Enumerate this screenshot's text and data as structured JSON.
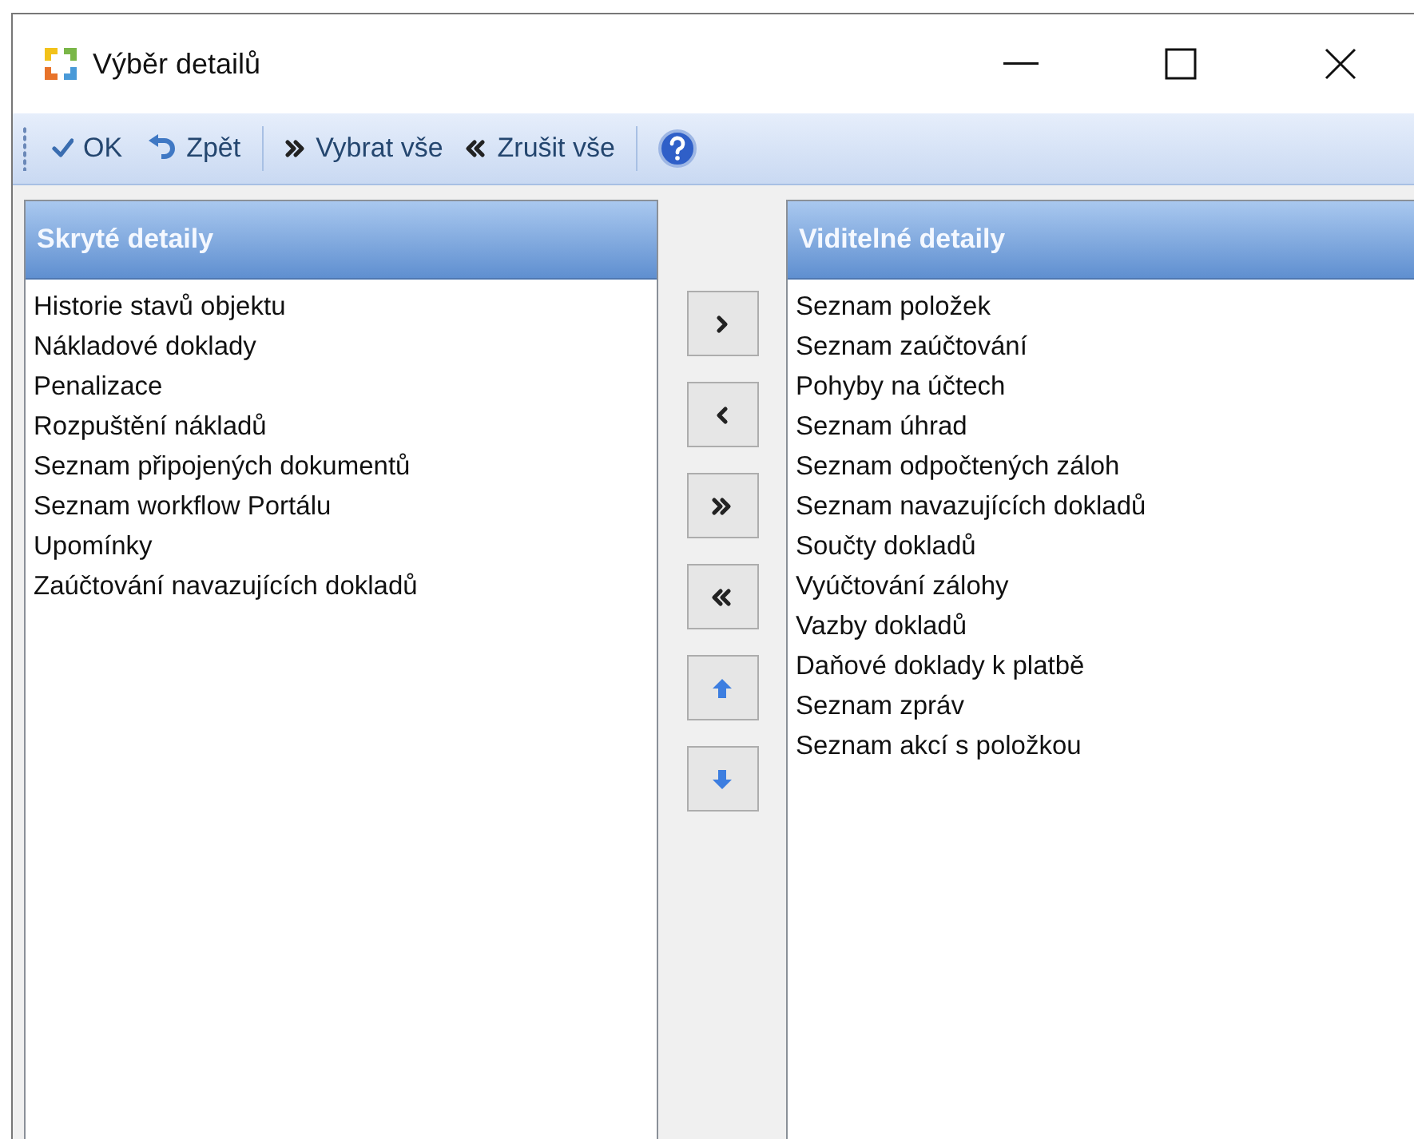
{
  "window": {
    "title": "Výběr detailů"
  },
  "toolbar": [
    {
      "kind": "ok",
      "label": "OK"
    },
    {
      "kind": "back",
      "label": "Zpět"
    },
    {
      "kind": "separator"
    },
    {
      "kind": "select_all",
      "label": "Vybrat vše"
    },
    {
      "kind": "clear_all",
      "label": "Zrušit vše"
    },
    {
      "kind": "separator"
    },
    {
      "kind": "help"
    }
  ],
  "hidden_panel": {
    "title": "Skryté detaily",
    "items": [
      "Historie stavů objektu",
      "Nákladové doklady",
      "Penalizace",
      "Rozpuštění nákladů",
      "Seznam připojených dokumentů",
      "Seznam workflow Portálu",
      "Upomínky",
      "Zaúčtování navazujících dokladů"
    ]
  },
  "move_buttons": [
    {
      "kind": "right"
    },
    {
      "kind": "left"
    },
    {
      "kind": "all_right"
    },
    {
      "kind": "all_left"
    },
    {
      "kind": "up"
    },
    {
      "kind": "down"
    }
  ],
  "visible_panel": {
    "title": "Viditelné detaily",
    "items": [
      "Seznam položek",
      "Seznam zaúčtování",
      "Pohyby na účtech",
      "Seznam úhrad",
      "Seznam odpočtených záloh",
      "Seznam navazujících dokladů",
      "Součty dokladů",
      "Vyúčtování zálohy",
      "Vazby dokladů",
      "Daňové doklady k platbě",
      "Seznam zpráv",
      "Seznam akcí s položkou"
    ]
  }
}
